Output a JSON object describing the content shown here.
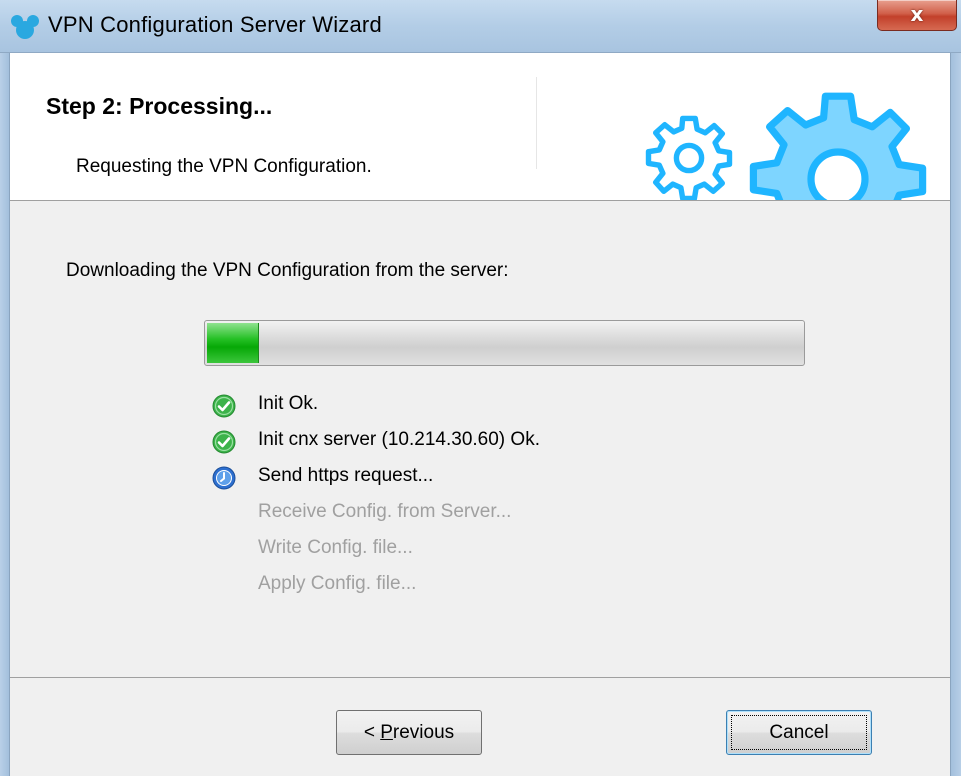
{
  "window": {
    "title": "VPN Configuration Server Wizard",
    "close_glyph": "x",
    "app_icon": "mickey-head-icon"
  },
  "header": {
    "title": "Step 2: Processing...",
    "subtitle": "Requesting the VPN Configuration.",
    "icons": [
      "gear-icon",
      "gear-icon"
    ]
  },
  "content": {
    "label": "Downloading the VPN Configuration from the server:",
    "progress_fraction": 0.085,
    "steps": [
      {
        "text": "Init Ok.",
        "status": "done",
        "icon": "check-circle-icon"
      },
      {
        "text": "Init cnx server (10.214.30.60) Ok.",
        "status": "done",
        "icon": "check-circle-icon"
      },
      {
        "text": "Send https request...",
        "status": "in-progress",
        "icon": "clock-icon"
      },
      {
        "text": "Receive Config. from Server...",
        "status": "pending",
        "icon": ""
      },
      {
        "text": "Write Config. file...",
        "status": "pending",
        "icon": ""
      },
      {
        "text": "Apply Config. file...",
        "status": "pending",
        "icon": ""
      }
    ]
  },
  "footer": {
    "previous_prefix": "< ",
    "previous_mnemonic": "P",
    "previous_rest": "revious",
    "cancel_label": "Cancel"
  },
  "colors": {
    "accent_gear": "#1fb5ff",
    "gear_fill": "#7ed5ff",
    "progress_green": "#0aa80a",
    "done_green": "#3cb34a",
    "in_progress_blue": "#2d6fcf",
    "pending_text": "#a0a0a0"
  }
}
